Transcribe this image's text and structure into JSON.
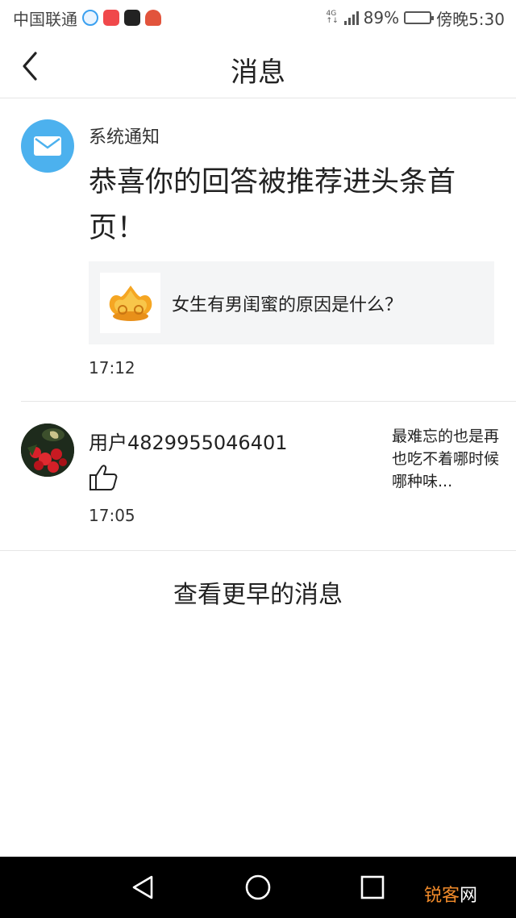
{
  "status_bar": {
    "carrier": "中国联通",
    "network": "4G",
    "battery_percent": "89%",
    "battery_level": 0.89,
    "time": "傍晚5:30"
  },
  "header": {
    "title": "消息",
    "back_icon": "chevron-left-icon"
  },
  "messages": [
    {
      "sender": "系统通知",
      "avatar_icon": "mail-icon",
      "avatar_color": "#4cb1ee",
      "headline": "恭喜你的回答被推荐进头条首页！",
      "card": {
        "title": "女生有男闺蜜的原因是什么？",
        "thumb_icon": "toutiao-gold-logo"
      },
      "time": "17:12"
    },
    {
      "sender": "用户4829955046401",
      "action_icon": "thumbs-up-icon",
      "snippet": "最难忘的也是再也吃不着哪时候哪种味...",
      "time": "17:05"
    }
  ],
  "load_more": "查看更早的消息",
  "nav_bar": {
    "back_icon": "triangle-back-icon",
    "home_icon": "circle-home-icon",
    "recents_icon": "square-recents-icon"
  },
  "watermark": {
    "accent": "锐客",
    "rest": "网",
    "accent_color": "#f08a2a"
  }
}
